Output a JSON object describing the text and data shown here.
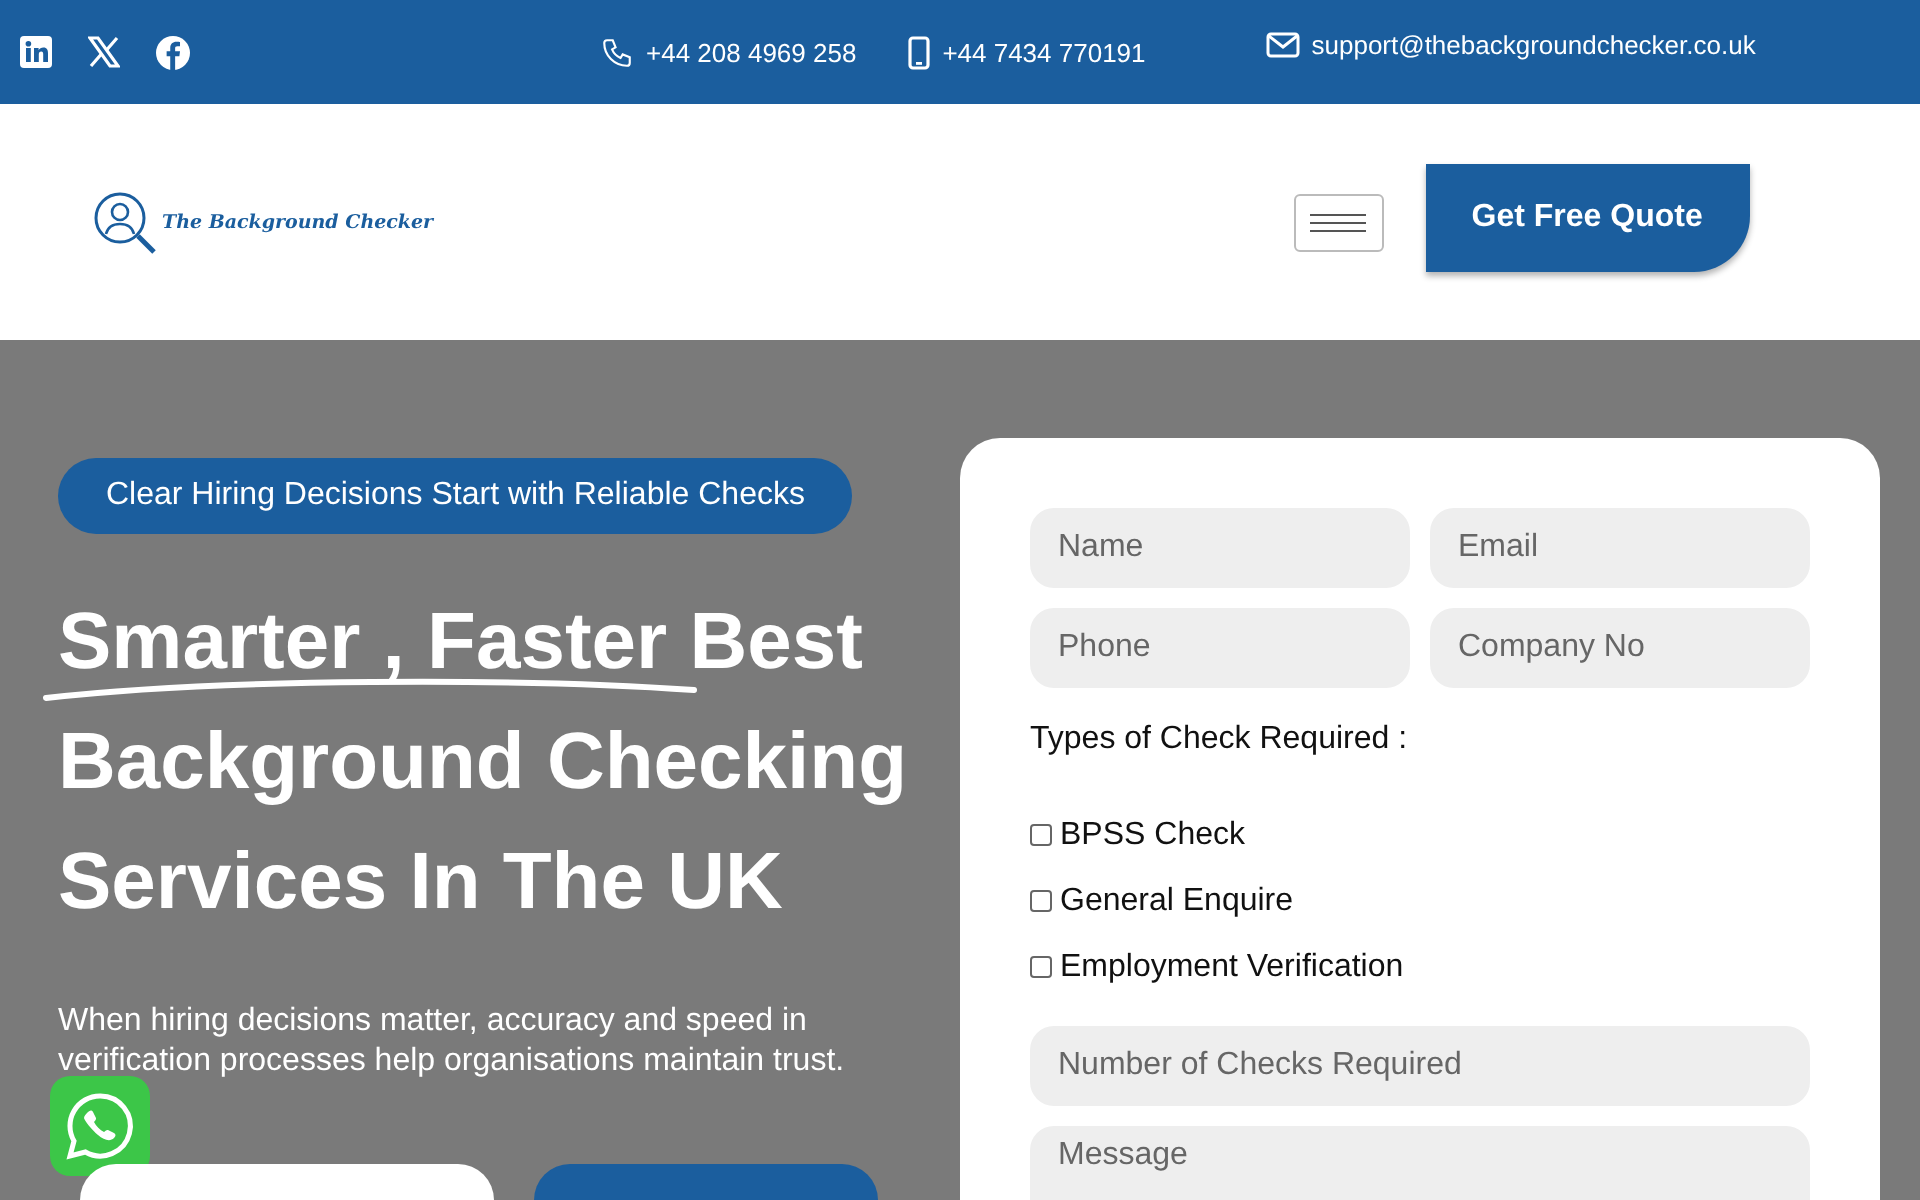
{
  "top_bar": {
    "phone": "+44 208 4969 258",
    "mobile": "+44 7434 770191",
    "email": "support@thebackgroundchecker.co.uk"
  },
  "header": {
    "logo_text": "The Background Checker",
    "quote_button": "Get Free Quote"
  },
  "hero": {
    "badge": "Clear Hiring Decisions Start with Reliable Checks",
    "heading_highlight": "Smarter , Faster",
    "heading_rest": "Best Background Checking Services In The UK",
    "description": "When hiring decisions matter, accuracy and speed in verification processes help organisations maintain trust."
  },
  "form": {
    "fields": [
      {
        "placeholder": "Name"
      },
      {
        "placeholder": "Email"
      },
      {
        "placeholder": "Phone"
      },
      {
        "placeholder": "Company No"
      }
    ],
    "checks_label": "Types of Check Required :",
    "checks": [
      {
        "label": "BPSS Check",
        "checked": false
      },
      {
        "label": "General Enquire",
        "checked": false
      },
      {
        "label": "Employment Verification",
        "checked": false
      }
    ],
    "count_placeholder": "Number of Checks Required",
    "message_placeholder": "Message"
  }
}
